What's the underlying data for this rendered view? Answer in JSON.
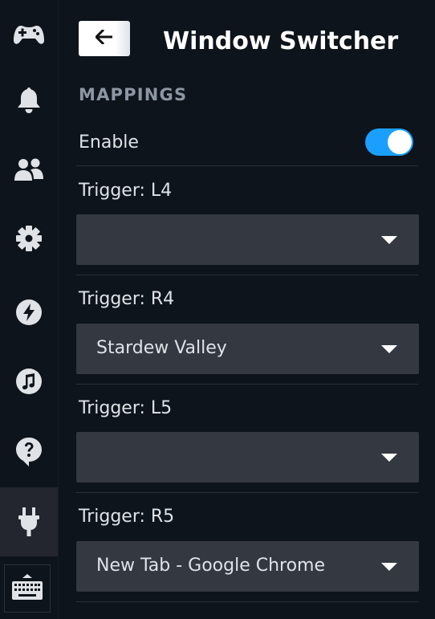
{
  "sidebar": {
    "items": [
      {
        "icon": "gamepad-icon",
        "active": false
      },
      {
        "icon": "bell-icon",
        "active": false
      },
      {
        "icon": "friends-icon",
        "active": false
      },
      {
        "icon": "gear-icon",
        "active": false
      },
      {
        "icon": "lightning-icon",
        "active": false
      },
      {
        "icon": "music-icon",
        "active": false
      },
      {
        "icon": "help-icon",
        "active": false
      },
      {
        "icon": "plug-icon",
        "active": true
      }
    ],
    "keyboard_icon": "keyboard-icon"
  },
  "header": {
    "back_icon": "arrow-left-icon",
    "title": "Window Switcher"
  },
  "mappings": {
    "section_label": "MAPPINGS",
    "enable_label": "Enable",
    "enable_on": true,
    "triggers": [
      {
        "label": "Trigger: L4",
        "value": ""
      },
      {
        "label": "Trigger: R4",
        "value": "Stardew Valley"
      },
      {
        "label": "Trigger: L5",
        "value": ""
      },
      {
        "label": "Trigger: R5",
        "value": "New Tab - Google Chrome"
      }
    ]
  },
  "colors": {
    "background": "#0e141b",
    "accent": "#1a9fff",
    "dropdown": "#343841",
    "active_sidebar": "#23262e"
  }
}
